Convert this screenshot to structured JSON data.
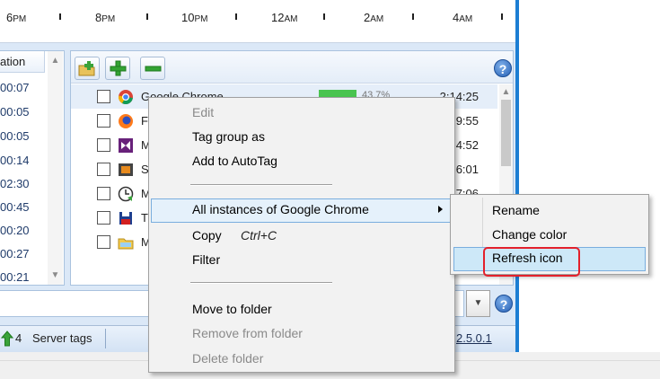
{
  "timeline": {
    "labels": [
      {
        "num": "6",
        "ampm": "PM"
      },
      {
        "num": "8",
        "ampm": "PM"
      },
      {
        "num": "10",
        "ampm": "PM"
      },
      {
        "num": "12",
        "ampm": "AM"
      },
      {
        "num": "2",
        "ampm": "AM"
      },
      {
        "num": "4",
        "ampm": "AM"
      }
    ]
  },
  "left_list": {
    "header": "ation",
    "times": [
      "00:07",
      "00:05",
      "00:05",
      "00:14",
      "02:30",
      "00:45",
      "00:20",
      "00:27",
      "00:21"
    ]
  },
  "apps": [
    {
      "name": "Google Chrome",
      "time": "2:14:25",
      "percent": "43.7%"
    },
    {
      "name": "F",
      "time": "9:55"
    },
    {
      "name": "M",
      "time": "4:52"
    },
    {
      "name": "S",
      "time": "6:01"
    },
    {
      "name": "M",
      "time": "7:06"
    },
    {
      "name": "T",
      "time": ""
    },
    {
      "name": "M",
      "time": ""
    }
  ],
  "statusbar": {
    "server_count": "4",
    "server_label": "Server tags",
    "version": "2.5.0.1"
  },
  "context_menu": {
    "edit": "Edit",
    "tag_group_as": "Tag group as",
    "add_to_autotag": "Add to AutoTag",
    "all_instances": "All instances of Google Chrome",
    "copy": "Copy",
    "copy_shortcut": "Ctrl+C",
    "filter": "Filter",
    "move_to_folder": "Move to folder",
    "remove_from_folder": "Remove from folder",
    "delete_folder": "Delete folder"
  },
  "submenu": {
    "rename": "Rename",
    "change_color": "Change color",
    "refresh_icon": "Refresh icon"
  },
  "help_glyph": "?",
  "colors": {
    "accent_blue": "#1c7ed3",
    "highlight_outline": "#e3202b",
    "usage_bar": "#49c44f"
  }
}
